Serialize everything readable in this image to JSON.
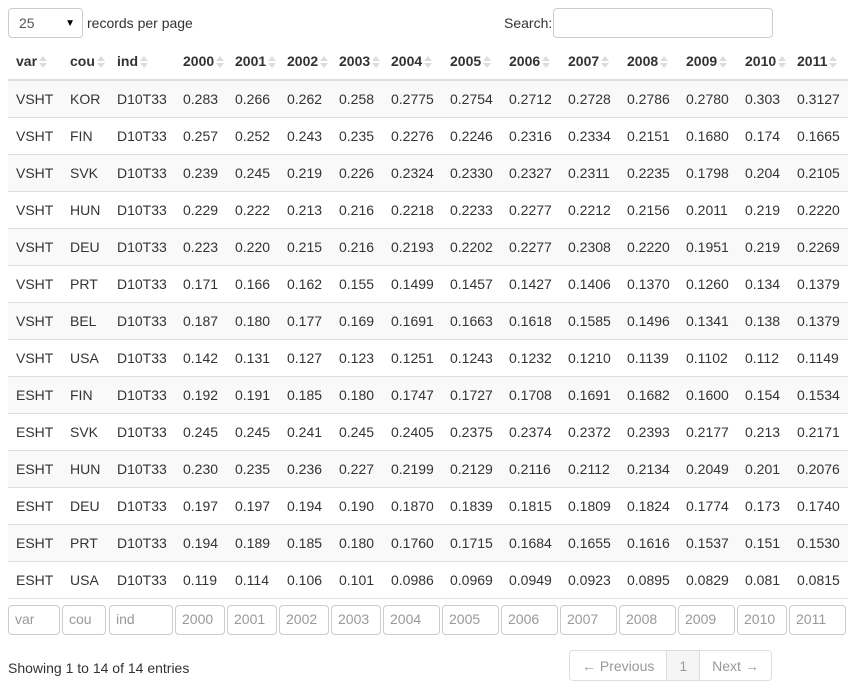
{
  "length_control": {
    "selected": "25",
    "caret_icon": "triangle-down",
    "label": "records per page"
  },
  "search": {
    "label": "Search:",
    "value": "",
    "placeholder": ""
  },
  "table": {
    "columns": [
      "var",
      "cou",
      "ind",
      "2000",
      "2001",
      "2002",
      "2003",
      "2004",
      "2005",
      "2006",
      "2007",
      "2008",
      "2009",
      "2010",
      "2011"
    ],
    "rows": [
      [
        "VSHT",
        "KOR",
        "D10T33",
        "0.283",
        "0.266",
        "0.262",
        "0.258",
        "0.2775",
        "0.2754",
        "0.2712",
        "0.2728",
        "0.2786",
        "0.2780",
        "0.303",
        "0.3127"
      ],
      [
        "VSHT",
        "FIN",
        "D10T33",
        "0.257",
        "0.252",
        "0.243",
        "0.235",
        "0.2276",
        "0.2246",
        "0.2316",
        "0.2334",
        "0.2151",
        "0.1680",
        "0.174",
        "0.1665"
      ],
      [
        "VSHT",
        "SVK",
        "D10T33",
        "0.239",
        "0.245",
        "0.219",
        "0.226",
        "0.2324",
        "0.2330",
        "0.2327",
        "0.2311",
        "0.2235",
        "0.1798",
        "0.204",
        "0.2105"
      ],
      [
        "VSHT",
        "HUN",
        "D10T33",
        "0.229",
        "0.222",
        "0.213",
        "0.216",
        "0.2218",
        "0.2233",
        "0.2277",
        "0.2212",
        "0.2156",
        "0.2011",
        "0.219",
        "0.2220"
      ],
      [
        "VSHT",
        "DEU",
        "D10T33",
        "0.223",
        "0.220",
        "0.215",
        "0.216",
        "0.2193",
        "0.2202",
        "0.2277",
        "0.2308",
        "0.2220",
        "0.1951",
        "0.219",
        "0.2269"
      ],
      [
        "VSHT",
        "PRT",
        "D10T33",
        "0.171",
        "0.166",
        "0.162",
        "0.155",
        "0.1499",
        "0.1457",
        "0.1427",
        "0.1406",
        "0.1370",
        "0.1260",
        "0.134",
        "0.1379"
      ],
      [
        "VSHT",
        "BEL",
        "D10T33",
        "0.187",
        "0.180",
        "0.177",
        "0.169",
        "0.1691",
        "0.1663",
        "0.1618",
        "0.1585",
        "0.1496",
        "0.1341",
        "0.138",
        "0.1379"
      ],
      [
        "VSHT",
        "USA",
        "D10T33",
        "0.142",
        "0.131",
        "0.127",
        "0.123",
        "0.1251",
        "0.1243",
        "0.1232",
        "0.1210",
        "0.1139",
        "0.1102",
        "0.112",
        "0.1149"
      ],
      [
        "ESHT",
        "FIN",
        "D10T33",
        "0.192",
        "0.191",
        "0.185",
        "0.180",
        "0.1747",
        "0.1727",
        "0.1708",
        "0.1691",
        "0.1682",
        "0.1600",
        "0.154",
        "0.1534"
      ],
      [
        "ESHT",
        "SVK",
        "D10T33",
        "0.245",
        "0.245",
        "0.241",
        "0.245",
        "0.2405",
        "0.2375",
        "0.2374",
        "0.2372",
        "0.2393",
        "0.2177",
        "0.213",
        "0.2171"
      ],
      [
        "ESHT",
        "HUN",
        "D10T33",
        "0.230",
        "0.235",
        "0.236",
        "0.227",
        "0.2199",
        "0.2129",
        "0.2116",
        "0.2112",
        "0.2134",
        "0.2049",
        "0.201",
        "0.2076"
      ],
      [
        "ESHT",
        "DEU",
        "D10T33",
        "0.197",
        "0.197",
        "0.194",
        "0.190",
        "0.1870",
        "0.1839",
        "0.1815",
        "0.1809",
        "0.1824",
        "0.1774",
        "0.173",
        "0.1740"
      ],
      [
        "ESHT",
        "PRT",
        "D10T33",
        "0.194",
        "0.189",
        "0.185",
        "0.180",
        "0.1760",
        "0.1715",
        "0.1684",
        "0.1655",
        "0.1616",
        "0.1537",
        "0.151",
        "0.1530"
      ],
      [
        "ESHT",
        "USA",
        "D10T33",
        "0.119",
        "0.114",
        "0.106",
        "0.101",
        "0.0986",
        "0.0969",
        "0.0949",
        "0.0923",
        "0.0895",
        "0.0829",
        "0.081",
        "0.0815"
      ]
    ],
    "filter_placeholders": [
      "var",
      "cou",
      "ind",
      "2000",
      "2001",
      "2002",
      "2003",
      "2004",
      "2005",
      "2006",
      "2007",
      "2008",
      "2009",
      "2010",
      "2011"
    ],
    "sort_icon": "sort-both"
  },
  "footer": {
    "info": "Showing 1 to 14 of 14 entries",
    "pagination": {
      "previous": "← Previous",
      "current_page": "1",
      "next": "Next →"
    }
  }
}
